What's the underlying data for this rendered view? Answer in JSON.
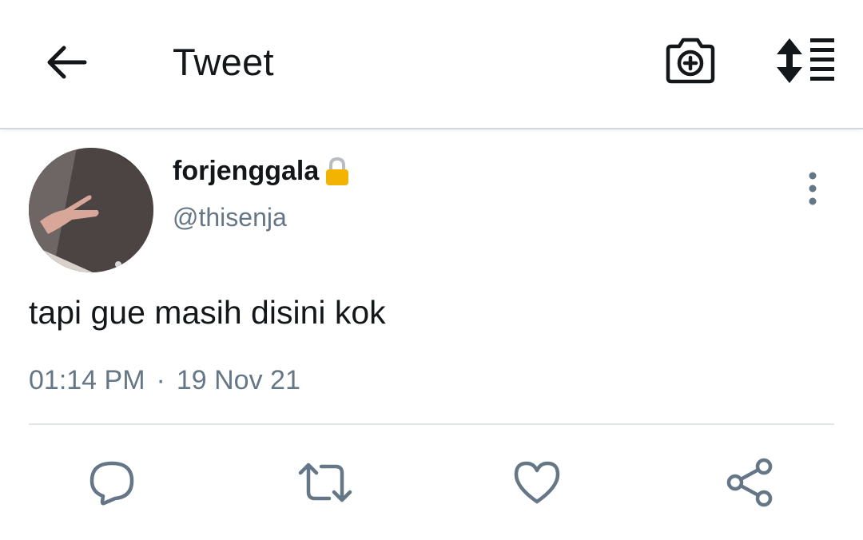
{
  "header": {
    "title": "Tweet",
    "back_icon": "arrow-left-icon",
    "camera_icon": "camera-plus-icon",
    "sort_icon": "sort-list-icon"
  },
  "tweet": {
    "display_name": "forjenggala",
    "handle": "@thisenja",
    "text": "tapi gue masih disini kok",
    "time": "01:14 PM",
    "separator": "·",
    "date": "19 Nov 21",
    "lock_icon": "lock-icon",
    "more_icon": "vertical-dots-icon"
  },
  "actions": {
    "reply_icon": "comment-icon",
    "retweet_icon": "retweet-icon",
    "like_icon": "heart-icon",
    "share_icon": "share-icon"
  },
  "colors": {
    "text_primary": "#14171a",
    "text_secondary": "#657786",
    "icon_gray": "#657786",
    "lock_gold": "#f2b400"
  }
}
